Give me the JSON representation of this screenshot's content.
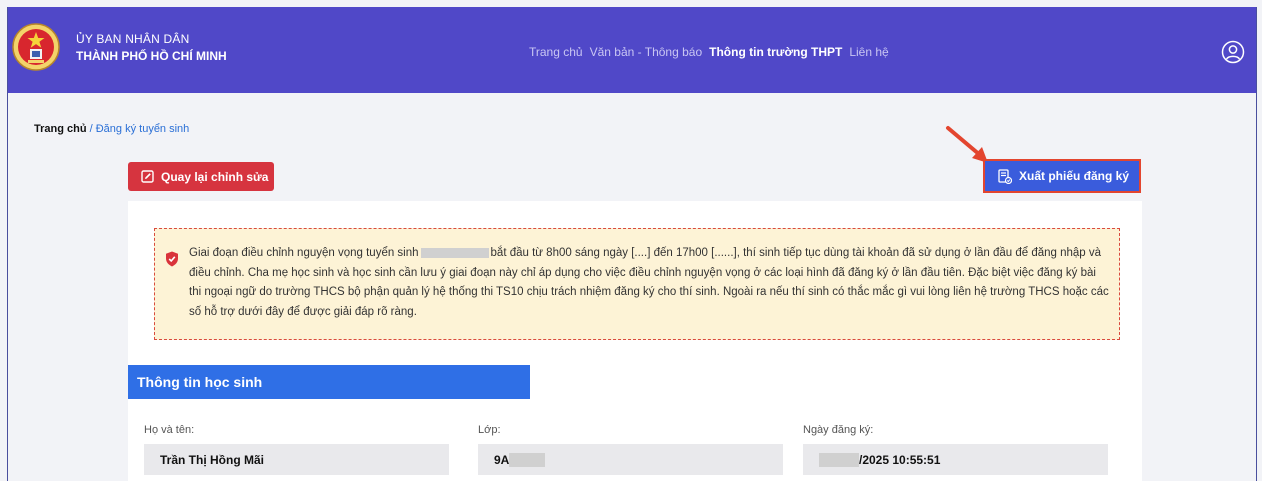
{
  "header": {
    "org_line1": "ỦY BAN NHÂN DÂN",
    "org_line2": "THÀNH PHỐ HỒ CHÍ MINH",
    "nav": [
      "Trang chủ",
      "Văn bản - Thông báo",
      "Thông tin trường THPT",
      "Liên hệ"
    ],
    "active_nav": "Thông tin trường THPT",
    "user_icon": "user-circle-icon",
    "color": "#5048c8"
  },
  "breadcrumb": {
    "home": "Trang chủ",
    "separator": " / ",
    "current": "Đăng ký tuyển sinh"
  },
  "actions": {
    "back_label": "Quay lại chỉnh sửa",
    "back_icon": "edit-icon",
    "back_color": "#d6343f",
    "export_label": "Xuất phiếu đăng ký",
    "export_icon": "document-export-icon",
    "export_color": "#3a5cdc"
  },
  "notice": {
    "icon": "shield-icon",
    "part1": "Giai đoạn điều chỉnh nguyện vọng tuyển sinh",
    "part2": "bắt đầu từ 8h00 sáng ngày [....] đến 17h00 [......], thí sinh tiếp tục dùng tài khoản đã sử dụng ở lần đầu để đăng nhập và điều chỉnh. Cha mẹ học sinh và học sinh cần lưu ý giai đoạn này chỉ áp dụng cho việc điều chỉnh nguyện vọng ở các loại hình đã đăng ký ở lần đầu tiên. Đặc biệt việc đăng ký bài thi ngoại ngữ do trường THCS bộ phận quản lý hệ thống thi TS10 chịu trách nhiệm đăng ký cho thí sinh. Ngoài ra nếu thí sinh có thắc mắc gì vui lòng liên hệ trường THCS hoặc các số hỗ trợ dưới đây để được giải đáp rõ ràng."
  },
  "student": {
    "section_title": "Thông tin học sinh",
    "name_label": "Họ và tên:",
    "name_value": "Trần Thị Hồng Mãi",
    "class_label": "Lớp:",
    "class_value": "9A",
    "date_label": "Ngày đăng ký:",
    "date_value": "/2025 10:55:51"
  }
}
